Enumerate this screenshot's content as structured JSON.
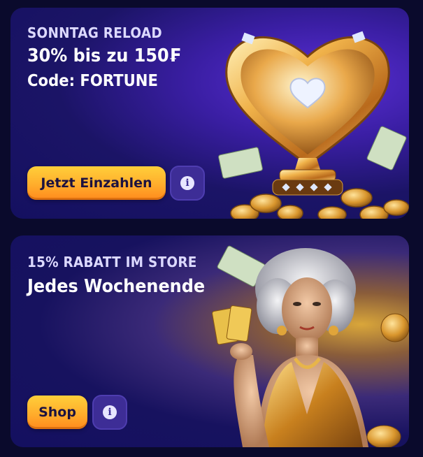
{
  "promos": [
    {
      "eyebrow": "SONNTAG RELOAD",
      "headline": "30% bis zu 150₣",
      "code": "Code: FORTUNE",
      "cta_label": "Jetzt Einzahlen",
      "info_symbol": "i",
      "image": "golden-heart-trophy-with-coins-and-banknotes"
    },
    {
      "eyebrow": "15% RABATT IM STORE",
      "headline": "Jedes Wochenende",
      "cta_label": "Shop",
      "info_symbol": "i",
      "image": "silver-haired-woman-in-gold-dress-holding-cards"
    }
  ],
  "colors": {
    "page_bg": "#0a0a2c",
    "card_bg": "#15115a",
    "cta_gradient_top": "#ffcf3a",
    "cta_gradient_bottom": "#ff8a1d",
    "info_bg": "#3d2d96",
    "text_primary": "#ffffff",
    "text_eyebrow": "#dcd9ff"
  }
}
